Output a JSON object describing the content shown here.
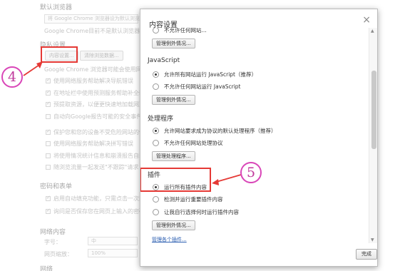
{
  "background": {
    "default_browser_heading": "默认浏览器",
    "default_browser_button": "将 Google Chrome 浏览器设为默认浏览器",
    "default_browser_note": "Google Chrome目前不是默认浏览器。",
    "privacy_heading": "隐私设置",
    "content_settings_button": "内容设置...",
    "clear_data_button": "清除浏览数据...",
    "privacy_note": "Google Chrome 浏览器可能会使用网络服务来",
    "privacy_options": [
      "使用网络服务帮助解决导航错误",
      "在地址栏中使用预测服务帮助补全输入",
      "预提取资源，以便更快速地加载网页",
      "自动向Google报告可能的安全事件详细",
      "保护您和您的设备不受危险网站的侵害",
      "使用网络服务帮助解决拼写错误",
      "将使用情况统计信息和崩溃报告自动",
      "随浏览流量一起发送\"不跟踪\"请求"
    ],
    "passwords_heading": "密码和表单",
    "password_options": [
      "启用自动填充功能，只需点击一次即可填写",
      "询问是否保存您在网页上输入的密码。"
    ],
    "web_content_heading": "网络内容",
    "font_size_label": "字号：",
    "font_size_value": "中",
    "page_zoom_label": "网页缩放：",
    "page_zoom_value": "100%",
    "network_heading": "网络"
  },
  "annotations": {
    "step_4": "4",
    "step_5": "5",
    "colors": {
      "box": "#e53935",
      "circle": "#d946b8",
      "arrow": "#e53935"
    }
  },
  "dialog": {
    "title": "内容设置",
    "close_icon": "close-icon",
    "top_partial_option": "不允许任何网站...",
    "sections": {
      "images": {
        "manage_button": "管理例外情况..."
      },
      "javascript": {
        "title": "JavaScript",
        "options": [
          "允许所有网站运行 JavaScript（推荐）",
          "不允许任何网站运行 JavaScript"
        ],
        "manage_button": "管理例外情况..."
      },
      "handlers": {
        "title": "处理程序",
        "options": [
          "允许网站要求成为协议的默认处理程序（推荐）",
          "不允许任何网站处理协议"
        ],
        "manage_button": "管理处理程序..."
      },
      "plugins": {
        "title": "插件",
        "options": [
          "运行所有插件内容",
          "检测并运行重要插件内容",
          "让我自行选择何时运行插件内容"
        ],
        "manage_button": "管理例外情况...",
        "link": "管理各个插件..."
      }
    },
    "done_button": "完成"
  }
}
